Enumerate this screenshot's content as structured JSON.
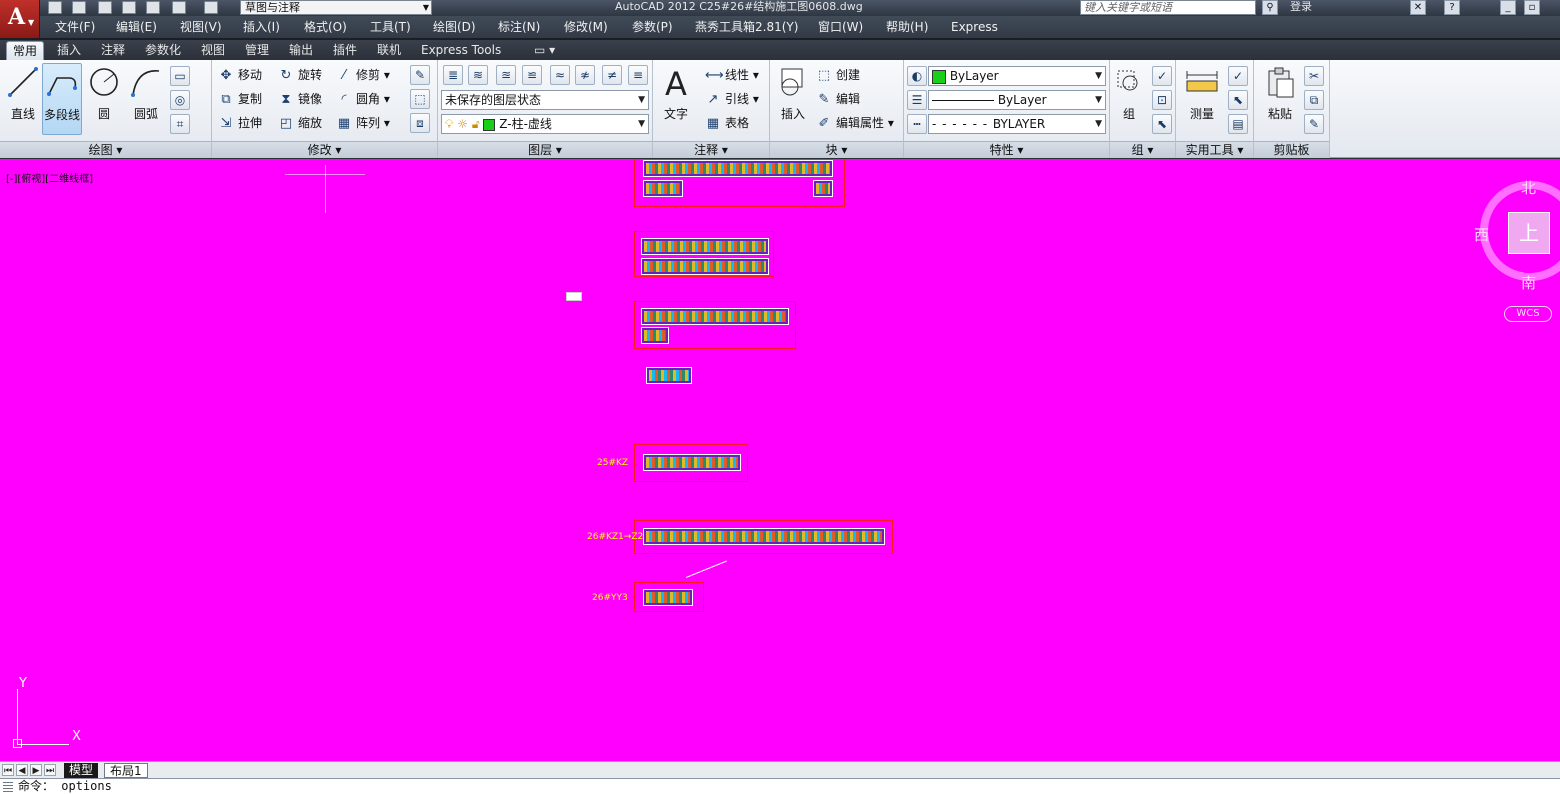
{
  "title_bar": {
    "workspace": "草图与注释",
    "title": "AutoCAD 2012     C25#26#结构施工图0608.dwg",
    "search_placeholder": "键入关键字或短语",
    "login": "登录"
  },
  "menu": [
    "文件(F)",
    "编辑(E)",
    "视图(V)",
    "插入(I)",
    "格式(O)",
    "工具(T)",
    "绘图(D)",
    "标注(N)",
    "修改(M)",
    "参数(P)",
    "燕秀工具箱2.81(Y)",
    "窗口(W)",
    "帮助(H)",
    "Express"
  ],
  "ribbon_tabs": [
    "常用",
    "插入",
    "注释",
    "参数化",
    "视图",
    "管理",
    "输出",
    "插件",
    "联机",
    "Express Tools"
  ],
  "ribbon": {
    "draw": {
      "title": "绘图",
      "line": "直线",
      "polyline": "多段线",
      "circle": "圆",
      "arc": "圆弧"
    },
    "modify": {
      "title": "修改",
      "move": "移动",
      "rotate": "旋转",
      "trim": "修剪",
      "copy": "复制",
      "mirror": "镜像",
      "fillet": "圆角",
      "stretch": "拉伸",
      "scale": "缩放",
      "array": "阵列"
    },
    "layers": {
      "title": "图层",
      "state": "未保存的图层状态",
      "current": "Z-柱-虚线"
    },
    "annotation": {
      "title": "注释",
      "text": "文字",
      "linear": "线性",
      "leader": "引线",
      "table": "表格"
    },
    "block": {
      "title": "块",
      "insert": "插入",
      "create": "创建",
      "edit": "编辑",
      "edit_attr": "编辑属性"
    },
    "properties": {
      "title": "特性",
      "color": "ByLayer",
      "lineweight": "ByLayer",
      "linetype": "BYLAYER"
    },
    "groups": {
      "title": "组",
      "group": "组"
    },
    "utilities": {
      "title": "实用工具",
      "measure": "测量"
    },
    "clipboard": {
      "title": "剪贴板",
      "paste": "粘贴"
    }
  },
  "canvas": {
    "viewport_label": "[-][俯视][二维线框]",
    "row_labels": [
      "25#KZ",
      "26#KZ1→Z2",
      "26#YY3"
    ],
    "viewcube": {
      "top": "上",
      "north": "北",
      "south": "南",
      "west": "西",
      "wcs": "WCS"
    },
    "ucs": {
      "x": "X",
      "y": "Y"
    },
    "colors": {
      "background": "#ff00ff",
      "frame": "#ff1a1a",
      "label": "#ffff00"
    }
  },
  "layout_tabs": [
    "模型",
    "布局1"
  ],
  "command": {
    "prompt": "命令：",
    "text": "options"
  }
}
